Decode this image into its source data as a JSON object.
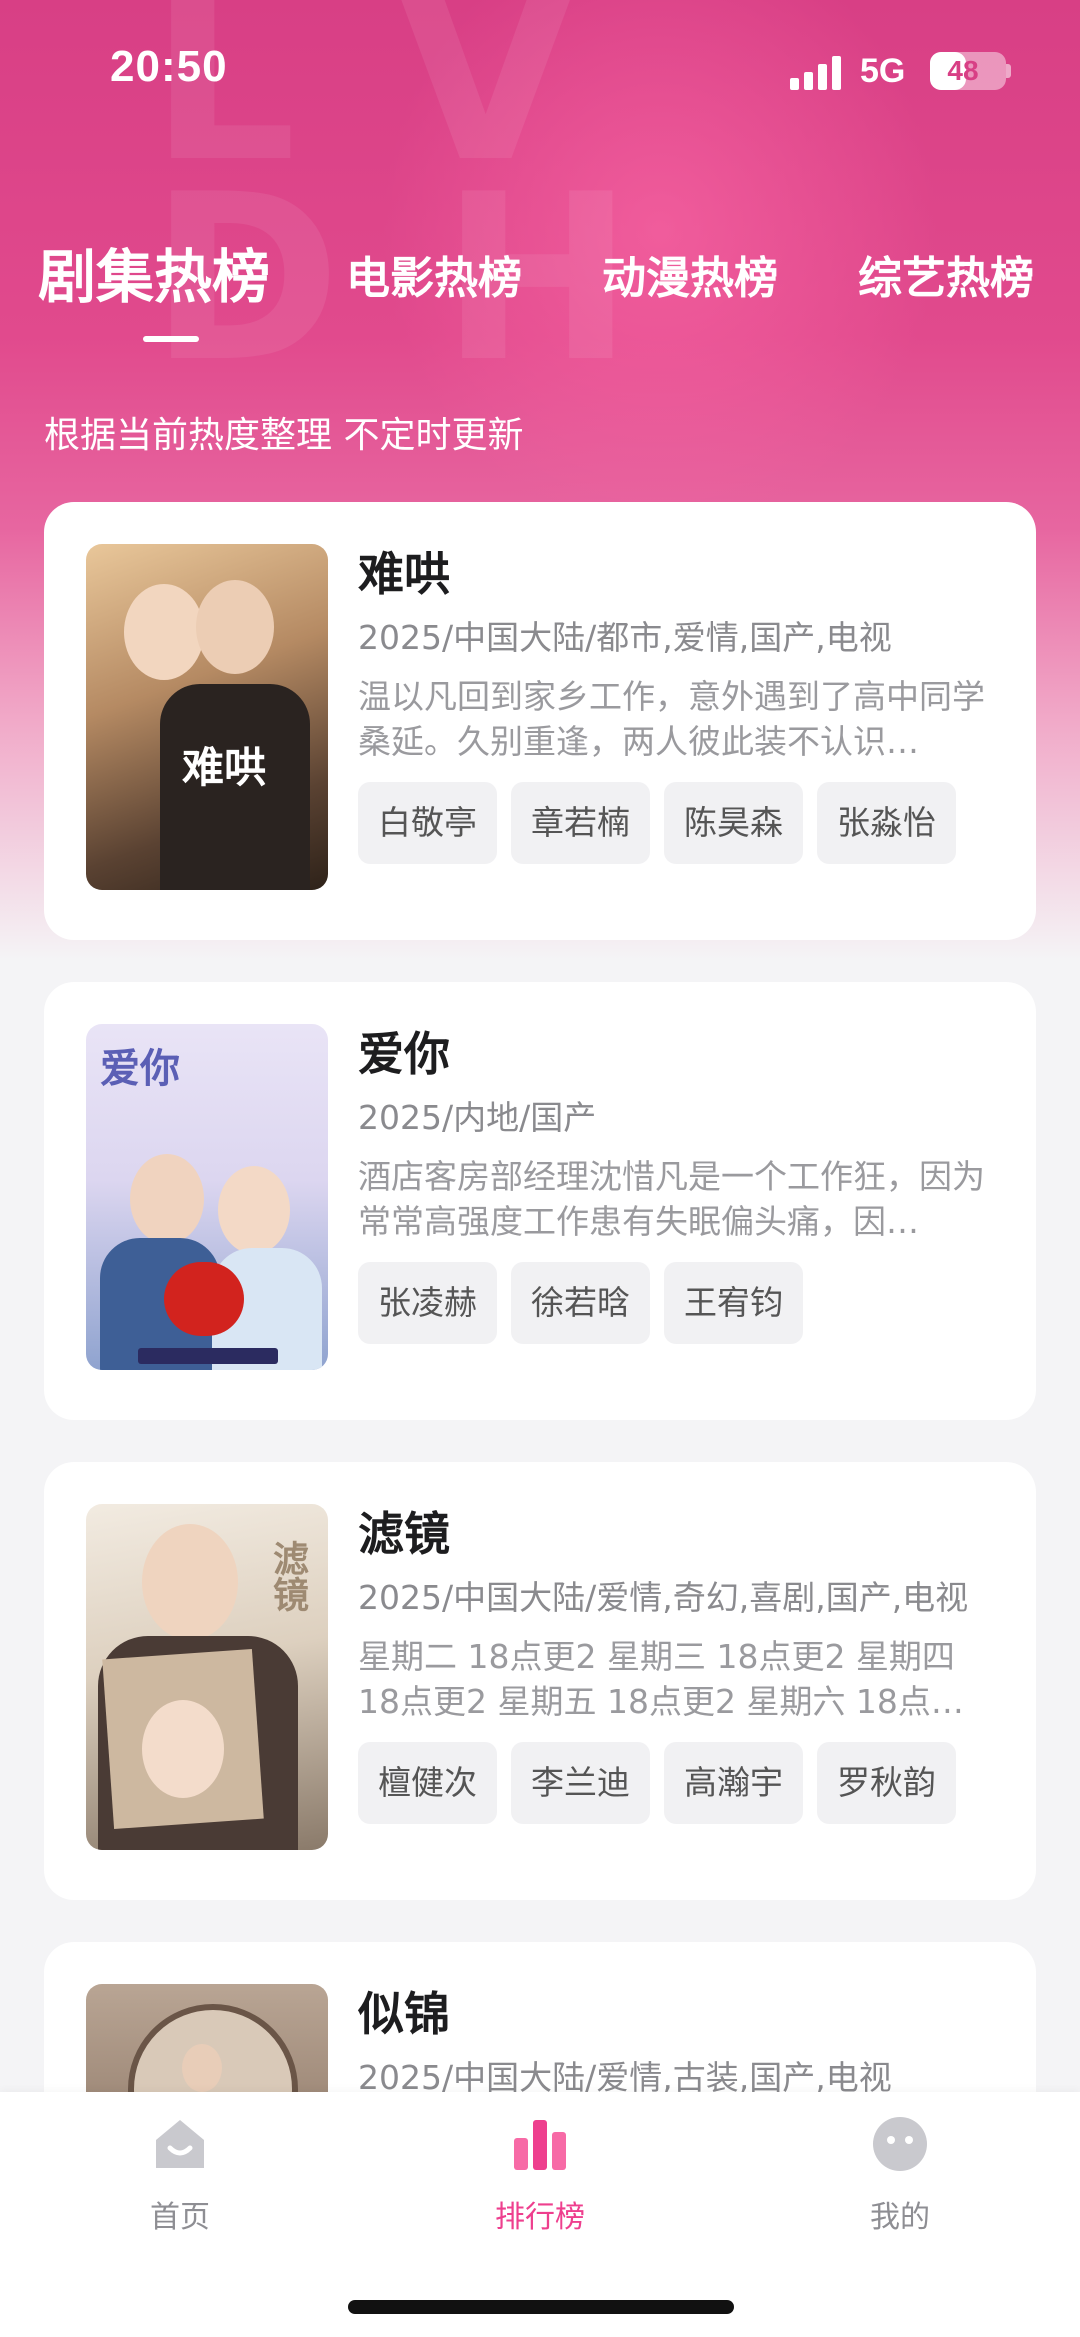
{
  "status_bar": {
    "time": "20:50",
    "network": "5G",
    "battery": "48",
    "battery_level": 0.48
  },
  "tabs": [
    {
      "label": "剧集热榜",
      "active": true
    },
    {
      "label": "电影热榜",
      "active": false
    },
    {
      "label": "动漫热榜",
      "active": false
    },
    {
      "label": "综艺热榜",
      "active": false
    }
  ],
  "subtitle": "根据当前热度整理 不定时更新",
  "items": [
    {
      "title": "难哄",
      "meta": "2025/中国大陆/都市,爱情,国产,电视",
      "desc": "温以凡回到家乡工作，意外遇到了高中同学桑延。久别重逢，两人彼此装不认识…",
      "tags": [
        "白敬亭",
        "章若楠",
        "陈昊森",
        "张淼怡"
      ]
    },
    {
      "title": "爱你",
      "meta": "2025/内地/国产",
      "desc": "酒店客房部经理沈惜凡是一个工作狂，因为常常高强度工作患有失眠偏头痛，因…",
      "tags": [
        "张凌赫",
        "徐若晗",
        "王宥钧"
      ]
    },
    {
      "title": "滤镜",
      "meta": "2025/中国大陆/爱情,奇幻,喜剧,国产,电视",
      "desc": "星期二 18点更2 星期三 18点更2 星期四 18点更2 星期五 18点更2 星期六 18点…",
      "tags": [
        "檀健次",
        "李兰迪",
        "高瀚宇",
        "罗秋韵"
      ]
    },
    {
      "title": "似锦",
      "meta": "2025/中国大陆/爱情,古装,国产,电视",
      "desc": "",
      "tags": []
    }
  ],
  "bottom_nav": [
    {
      "label": "首页",
      "icon": "home-icon",
      "active": false
    },
    {
      "label": "排行榜",
      "icon": "ranking-bars-icon",
      "active": true
    },
    {
      "label": "我的",
      "icon": "profile-smiley-icon",
      "active": false
    }
  ],
  "colors": {
    "accent": "#ee3f8e",
    "header": "#d83f85",
    "background": "#f4f4f6"
  }
}
